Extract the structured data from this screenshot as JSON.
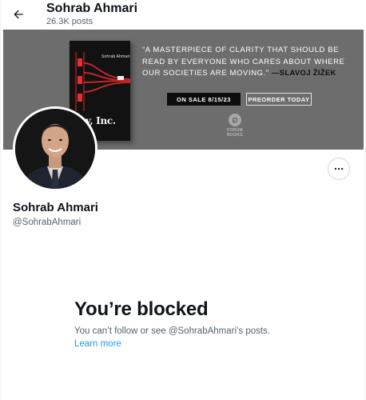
{
  "header": {
    "back_icon": "arrow-left-icon",
    "name": "Sohrab Ahmari",
    "post_count": "26.3K posts"
  },
  "banner": {
    "book": {
      "author": "Sohrab Ahmari",
      "title": "Tyranny, Inc.",
      "title_visible": "nny, Inc."
    },
    "quote": "“A MASTERPIECE OF CLARITY THAT SHOULD BE READ BY EVERYONE WHO CARES ABOUT WHERE OUR SOCIETIES ARE MOVING.”",
    "quote_attribution": "—SLAVOJ ŽIŽEK",
    "on_sale": "ON SALE 8/15/23",
    "preorder": "PREORDER TODAY",
    "publisher": "FORUM BOOKS",
    "background_color": "#6d6d6d"
  },
  "profile": {
    "name": "Sohrab Ahmari",
    "handle": "@SohrabAhmari",
    "more_icon": "more-dots-icon"
  },
  "blocked": {
    "title": "You’re blocked",
    "message": "You can’t follow or see @SohrabAhmari’s posts.",
    "learn_more": "Learn more",
    "link_color": "#1d9bf0"
  }
}
